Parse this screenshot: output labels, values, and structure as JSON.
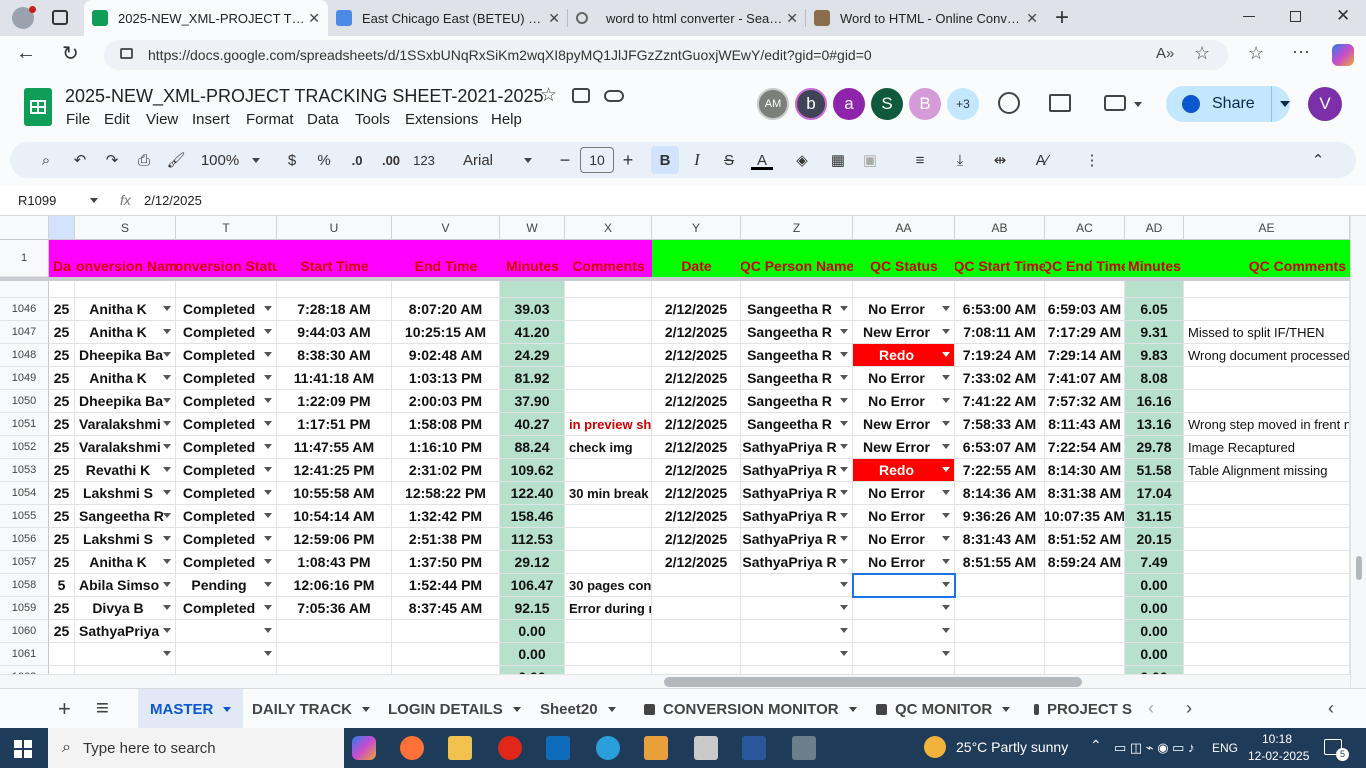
{
  "browser": {
    "tabs": [
      {
        "title": "2025-NEW_XML-PROJECT TRACK",
        "active": true
      },
      {
        "title": "East Chicago East (BETEU) - Goog"
      },
      {
        "title": "word to html converter - Search"
      },
      {
        "title": "Word to HTML - Online Converte"
      }
    ],
    "url": "https://docs.google.com/spreadsheets/d/1SSxbUNqRxSiKm2wqXI8pyMQ1JlJFGzZzntGuoxjWEwY/edit?gid=0#gid=0"
  },
  "doc": {
    "title": "2025-NEW_XML-PROJECT TRACKING SHEET-2021-2025",
    "menu": [
      "File",
      "Edit",
      "View",
      "Insert",
      "Format",
      "Data",
      "Tools",
      "Extensions",
      "Help"
    ],
    "collaborators": [
      {
        "label": "AM",
        "color": "#7d7f7a"
      },
      {
        "label": "b",
        "color": "#3d4556"
      },
      {
        "label": "a",
        "color": "#8e24aa"
      },
      {
        "label": "S",
        "color": "#0f5a3d"
      },
      {
        "label": "B",
        "color": "#d49bd8"
      }
    ],
    "more_collaborators": "+3",
    "share_label": "Share",
    "user_initial": "V"
  },
  "toolbar": {
    "zoom": "100%",
    "currency": "$",
    "percent": "%",
    "dec_decrease": ".0",
    "dec_increase": ".00",
    "number_format": "123",
    "font": "Arial",
    "font_size": "10",
    "bold": "B",
    "italic": "I",
    "strike": "S",
    "text_color": "A",
    "minus": "−",
    "plus": "+"
  },
  "formula_bar": {
    "cell_ref": "R1099",
    "fx": "fx",
    "value": "2/12/2025"
  },
  "grid": {
    "columns": [
      "S",
      "T",
      "U",
      "V",
      "W",
      "X",
      "Y",
      "Z",
      "AA",
      "AB",
      "AC",
      "AD",
      "AE"
    ],
    "header_row_number": "1",
    "header_row": [
      "Da",
      "Conversion Name",
      "Conversion Status",
      "Start Time",
      "End Time",
      "Minutes",
      "Comments",
      "Date",
      "QC Person Name",
      "QC Status",
      "QC Start Time",
      "QC End Time",
      "Minutes",
      "QC Comments"
    ],
    "rows": [
      {
        "n": "1046",
        "r": "25",
        "s": "Anitha K",
        "t": "Completed",
        "u": "7:28:18 AM",
        "v": "8:07:20 AM",
        "w": "39.03",
        "x": "",
        "y": "2/12/2025",
        "z": "Sangeetha R",
        "aa": "No Error",
        "ab": "6:53:00 AM",
        "ac": "6:59:03 AM",
        "ad": "6.05",
        "ae": ""
      },
      {
        "n": "1047",
        "r": "25",
        "s": "Anitha K",
        "t": "Completed",
        "u": "9:44:03 AM",
        "v": "10:25:15 AM",
        "w": "41.20",
        "x": "",
        "y": "2/12/2025",
        "z": "Sangeetha R",
        "aa": "New Error",
        "ab": "7:08:11 AM",
        "ac": "7:17:29 AM",
        "ad": "9.31",
        "ae": "Missed to split IF/THEN"
      },
      {
        "n": "1048",
        "r": "25",
        "s": "Dheepika Ba",
        "t": "Completed",
        "u": "8:38:30 AM",
        "v": "9:02:48 AM",
        "w": "24.29",
        "x": "",
        "y": "2/12/2025",
        "z": "Sangeetha R",
        "aa": "Redo",
        "ab": "7:19:24 AM",
        "ac": "7:29:14 AM",
        "ad": "9.83",
        "ae": "Wrong document processed"
      },
      {
        "n": "1049",
        "r": "25",
        "s": "Anitha K",
        "t": "Completed",
        "u": "11:41:18 AM",
        "v": "1:03:13 PM",
        "w": "81.92",
        "x": "",
        "y": "2/12/2025",
        "z": "Sangeetha R",
        "aa": "No Error",
        "ab": "7:33:02 AM",
        "ac": "7:41:07 AM",
        "ad": "8.08",
        "ae": ""
      },
      {
        "n": "1050",
        "r": "25",
        "s": "Dheepika Ba",
        "t": "Completed",
        "u": "1:22:09 PM",
        "v": "2:00:03 PM",
        "w": "37.90",
        "x": "",
        "y": "2/12/2025",
        "z": "Sangeetha R",
        "aa": "No Error",
        "ab": "7:41:22 AM",
        "ac": "7:57:32 AM",
        "ad": "16.16",
        "ae": ""
      },
      {
        "n": "1051",
        "r": "25",
        "s": "Varalakshmi",
        "t": "Completed",
        "u": "1:17:51 PM",
        "v": "1:58:08 PM",
        "w": "40.27",
        "x": "in preview sh",
        "y": "2/12/2025",
        "z": "Sangeetha R",
        "aa": "New Error",
        "ab": "7:58:33 AM",
        "ac": "8:11:43 AM",
        "ad": "13.16",
        "ae": "Wrong step moved in frent n"
      },
      {
        "n": "1052",
        "r": "25",
        "s": "Varalakshmi",
        "t": "Completed",
        "u": "11:47:55 AM",
        "v": "1:16:10 PM",
        "w": "88.24",
        "x": "check img",
        "y": "2/12/2025",
        "z": "SathyaPriya R",
        "aa": "New Error",
        "ab": "6:53:07 AM",
        "ac": "7:22:54 AM",
        "ad": "29.78",
        "ae": "Image Recaptured"
      },
      {
        "n": "1053",
        "r": "25",
        "s": "Revathi K",
        "t": "Completed",
        "u": "12:41:25 PM",
        "v": "2:31:02 PM",
        "w": "109.62",
        "x": "",
        "y": "2/12/2025",
        "z": "SathyaPriya R",
        "aa": "Redo",
        "ab": "7:22:55 AM",
        "ac": "8:14:30 AM",
        "ad": "51.58",
        "ae": "Table Alignment missing"
      },
      {
        "n": "1054",
        "r": "25",
        "s": "Lakshmi S",
        "t": "Completed",
        "u": "10:55:58 AM",
        "v": "12:58:22 PM",
        "w": "122.40",
        "x": "30 min break",
        "y": "2/12/2025",
        "z": "SathyaPriya R",
        "aa": "No Error",
        "ab": "8:14:36 AM",
        "ac": "8:31:38 AM",
        "ad": "17.04",
        "ae": ""
      },
      {
        "n": "1055",
        "r": "25",
        "s": "Sangeetha R",
        "t": "Completed",
        "u": "10:54:14 AM",
        "v": "1:32:42 PM",
        "w": "158.46",
        "x": "",
        "y": "2/12/2025",
        "z": "SathyaPriya R",
        "aa": "No Error",
        "ab": "9:36:26 AM",
        "ac": "10:07:35 AM",
        "ad": "31.15",
        "ae": ""
      },
      {
        "n": "1056",
        "r": "25",
        "s": "Lakshmi S",
        "t": "Completed",
        "u": "12:59:06 PM",
        "v": "2:51:38 PM",
        "w": "112.53",
        "x": "",
        "y": "2/12/2025",
        "z": "SathyaPriya R",
        "aa": "No Error",
        "ab": "8:31:43 AM",
        "ac": "8:51:52 AM",
        "ad": "20.15",
        "ae": ""
      },
      {
        "n": "1057",
        "r": "25",
        "s": "Anitha K",
        "t": "Completed",
        "u": "1:08:43 PM",
        "v": "1:37:50 PM",
        "w": "29.12",
        "x": "",
        "y": "2/12/2025",
        "z": "SathyaPriya R",
        "aa": "No Error",
        "ab": "8:51:55 AM",
        "ac": "8:59:24 AM",
        "ad": "7.49",
        "ae": ""
      },
      {
        "n": "1058",
        "r": "5",
        "s": "Abila Simso",
        "t": "Pending",
        "u": "12:06:16 PM",
        "v": "1:52:44 PM",
        "w": "106.47",
        "x": "30 pages con",
        "y": "",
        "z": "",
        "aa": "",
        "ab": "",
        "ac": "",
        "ad": "0.00",
        "ae": ""
      },
      {
        "n": "1059",
        "r": "25",
        "s": "Divya B",
        "t": "Completed",
        "u": "7:05:36 AM",
        "v": "8:37:45 AM",
        "w": "92.15",
        "x": "Error during ru",
        "y": "",
        "z": "",
        "aa": "",
        "ab": "",
        "ac": "",
        "ad": "0.00",
        "ae": ""
      },
      {
        "n": "1060",
        "r": "25",
        "s": "SathyaPriya",
        "t": "",
        "u": "",
        "v": "",
        "w": "0.00",
        "x": "",
        "y": "",
        "z": "",
        "aa": "",
        "ab": "",
        "ac": "",
        "ad": "0.00",
        "ae": ""
      },
      {
        "n": "1061",
        "r": "",
        "s": "",
        "t": "",
        "u": "",
        "v": "",
        "w": "0.00",
        "x": "",
        "y": "",
        "z": "",
        "aa": "",
        "ab": "",
        "ac": "",
        "ad": "0.00",
        "ae": ""
      },
      {
        "n": "1062",
        "r": "",
        "s": "",
        "t": "",
        "u": "",
        "v": "",
        "w": "0.00",
        "x": "",
        "y": "",
        "z": "",
        "aa": "",
        "ab": "",
        "ac": "",
        "ad": "0.00",
        "ae": ""
      }
    ]
  },
  "sheets": {
    "add": "+",
    "all": "≡",
    "tabs": [
      {
        "label": "MASTER",
        "active": true,
        "locked": false
      },
      {
        "label": "DAILY TRACK",
        "locked": false
      },
      {
        "label": "LOGIN DETAILS",
        "locked": false
      },
      {
        "label": "Sheet20",
        "locked": false
      },
      {
        "label": "CONVERSION MONITOR",
        "locked": true
      },
      {
        "label": "QC MONITOR",
        "locked": true
      },
      {
        "label": "PROJECT S",
        "locked": true
      }
    ]
  },
  "taskbar": {
    "search_placeholder": "Type here to search",
    "weather": "25°C  Partly sunny",
    "lang": "ENG",
    "time": "10:18",
    "date": "12-02-2025",
    "notifications": "5"
  },
  "colors": {
    "magenta": "#ff00ff",
    "green": "#00ff00",
    "minutes_bg": "#b7e1cd",
    "redo_bg": "#ff0000",
    "header_text": "#d00000",
    "accent": "#0b57d0",
    "share_bg": "#c2e7ff"
  }
}
